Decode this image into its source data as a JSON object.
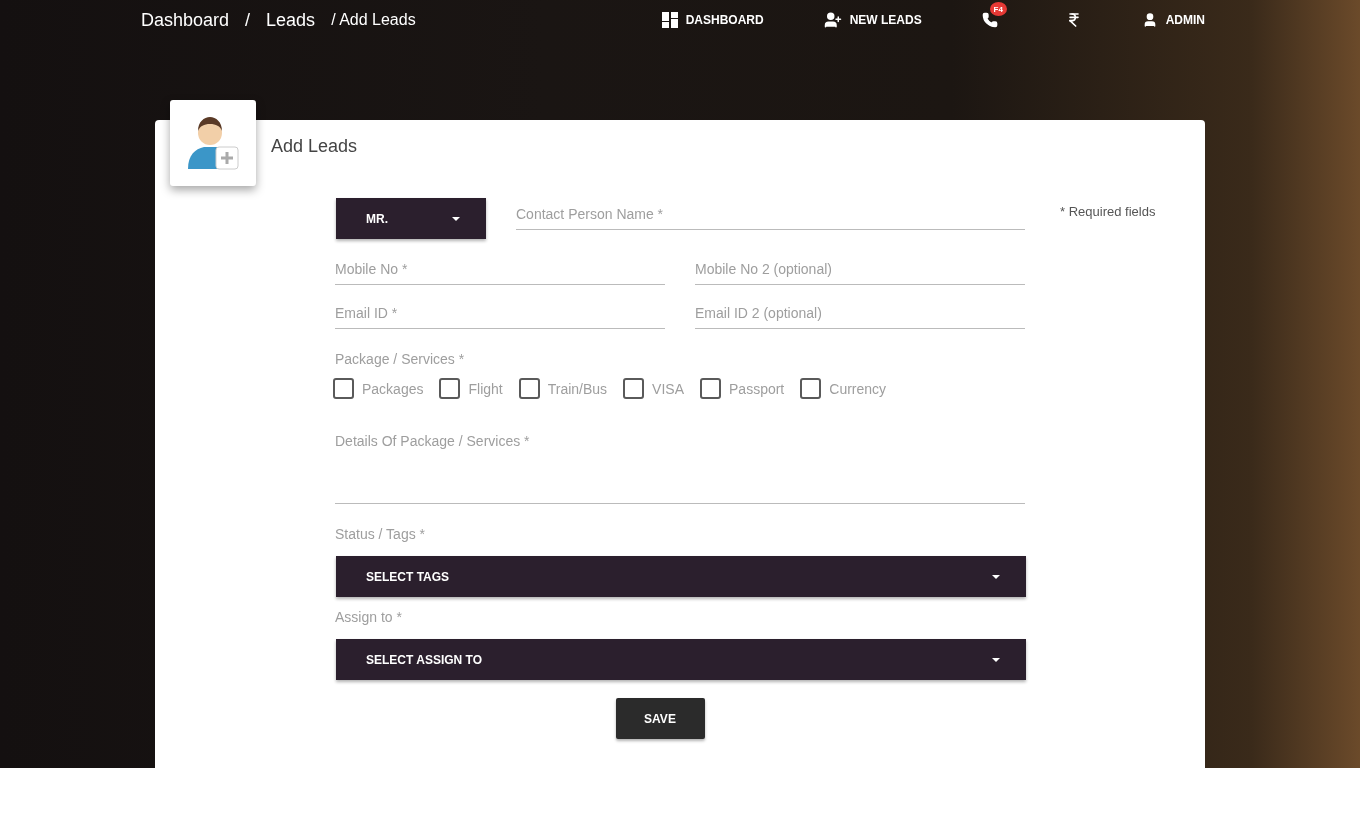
{
  "breadcrumbs": [
    "Dashboard",
    "/",
    "Leads",
    "/ Add Leads"
  ],
  "nav": [
    {
      "kind": "dashboard",
      "label": "DASHBOARD"
    },
    {
      "kind": "new-leads",
      "label": "NEW LEADS"
    },
    {
      "kind": "phone",
      "badge": "F4"
    },
    {
      "kind": "currency"
    },
    {
      "kind": "admin",
      "label": "ADMIN"
    }
  ],
  "card": {
    "title": "Add Leads",
    "required_note": "* Required fields"
  },
  "salutation": {
    "value": "MR."
  },
  "contact_name": {
    "placeholder": "Contact Person Name *"
  },
  "field_rows": [
    [
      {
        "placeholder": "Mobile No *"
      },
      {
        "placeholder": "Mobile No 2 (optional)"
      }
    ],
    [
      {
        "placeholder": "Email ID *"
      },
      {
        "placeholder": "Email ID 2 (optional)"
      }
    ]
  ],
  "services": {
    "label": "Package / Services *",
    "options": [
      {
        "label": "Packages",
        "checked": false
      },
      {
        "label": "Flight",
        "checked": false
      },
      {
        "label": "Train/Bus",
        "checked": false
      },
      {
        "label": "VISA",
        "checked": false
      },
      {
        "label": "Passport",
        "checked": false
      },
      {
        "label": "Currency",
        "checked": false
      }
    ]
  },
  "details": {
    "placeholder": "Details Of Package / Services *"
  },
  "status": {
    "label": "Status / Tags *",
    "select": "SELECT TAGS"
  },
  "assign": {
    "label": "Assign to *",
    "select": "SELECT ASSIGN TO"
  },
  "save_button": "SAVE"
}
